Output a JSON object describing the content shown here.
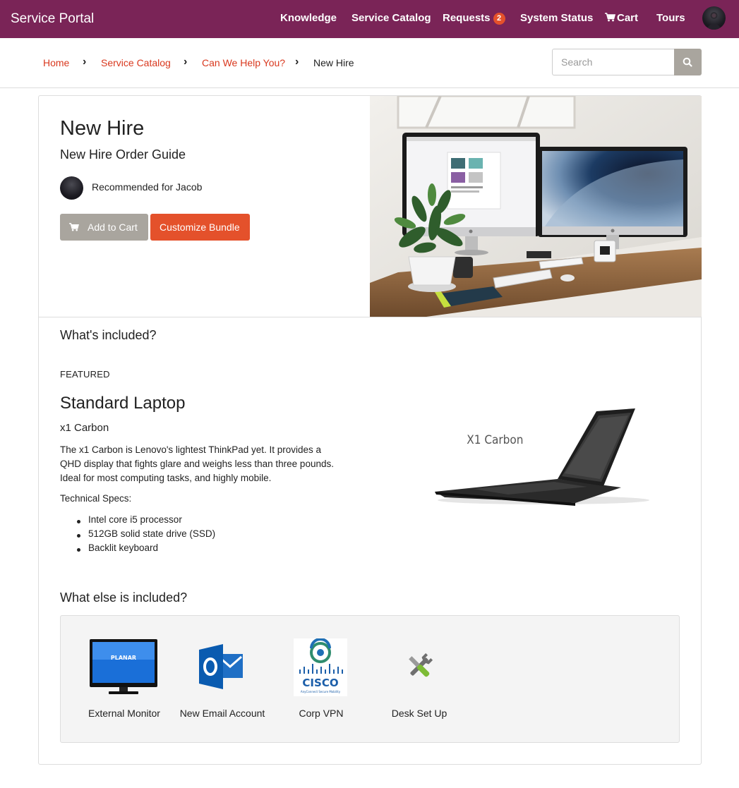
{
  "nav": {
    "brand": "Service Portal",
    "links": {
      "knowledge": "Knowledge",
      "service_catalog": "Service Catalog",
      "requests": "Requests",
      "requests_count": "2",
      "system_status": "System Status",
      "cart": "Cart",
      "tours": "Tours"
    }
  },
  "breadcrumb": {
    "items": [
      "Home",
      "Service Catalog",
      "Can We Help You?"
    ],
    "current": "New Hire",
    "separator": "›"
  },
  "search": {
    "placeholder": "Search"
  },
  "hero": {
    "title": "New Hire",
    "subtitle": "New Hire Order Guide",
    "recommended": "Recommended for Jacob",
    "add_to_cart": "Add to Cart",
    "customize": "Customize Bundle"
  },
  "included": {
    "heading": "What's included?",
    "featured_label": "FEATURED",
    "product": {
      "title": "Standard Laptop",
      "model": "x1 Carbon",
      "description": "The x1 Carbon is Lenovo's lightest ThinkPad yet. It provides a QHD display that fights glare and weighs less than three pounds. Ideal for most computing tasks, and highly mobile.",
      "specs_label": "Technical Specs:",
      "specs": [
        "Intel core i5 processor",
        "512GB solid state drive (SSD)",
        "Backlit keyboard"
      ],
      "image_caption": "X1 Carbon"
    }
  },
  "extras": {
    "heading": "What else is included?",
    "items": [
      {
        "name": "External Monitor",
        "icon": "monitor-icon",
        "logo_text": "PLANAR"
      },
      {
        "name": "New Email Account",
        "icon": "outlook-icon"
      },
      {
        "name": "Corp VPN",
        "icon": "cisco-icon",
        "logo_text": "CISCO",
        "logo_subtext": "AnyConnect Secure Mobility"
      },
      {
        "name": "Desk Set Up",
        "icon": "tools-icon"
      }
    ]
  },
  "colors": {
    "navbar": "#7a2457",
    "accent": "#e4512b",
    "link": "#d9381e",
    "gray_button": "#a9a59e"
  }
}
